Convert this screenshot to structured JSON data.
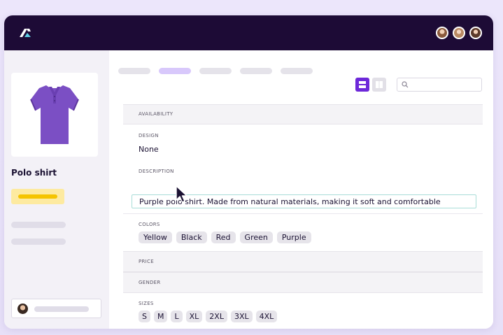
{
  "product": {
    "name": "Polo shirt",
    "image_icon": "polo-shirt-icon",
    "color": "#7b4fc4"
  },
  "fields": {
    "availability": {
      "label": "AVAILABILITY"
    },
    "design": {
      "label": "DESIGN",
      "value": "None"
    },
    "description": {
      "label": "DESCRIPTION",
      "value": "Purple polo shirt. Made from natural materials, making it soft and comfortable"
    },
    "colors": {
      "label": "COLORS",
      "options": [
        "Yellow",
        "Black",
        "Red",
        "Green",
        "Purple"
      ]
    },
    "price": {
      "label": "PRICE"
    },
    "gender": {
      "label": "GENDER"
    },
    "sizes": {
      "label": "SIZES",
      "options": [
        "S",
        "M",
        "L",
        "XL",
        "2XL",
        "3XL",
        "4XL"
      ]
    }
  },
  "theme": {
    "topbar": "#1d0b36",
    "accent": "#6d28d9",
    "highlight": "#f5c400",
    "focus_border": "#a9ddd8"
  },
  "icons": {
    "logo": "app-logo-icon",
    "search": "search-icon",
    "view_list": "list-view-icon",
    "view_grid": "grid-view-icon",
    "cursor": "cursor-pointer-icon"
  }
}
